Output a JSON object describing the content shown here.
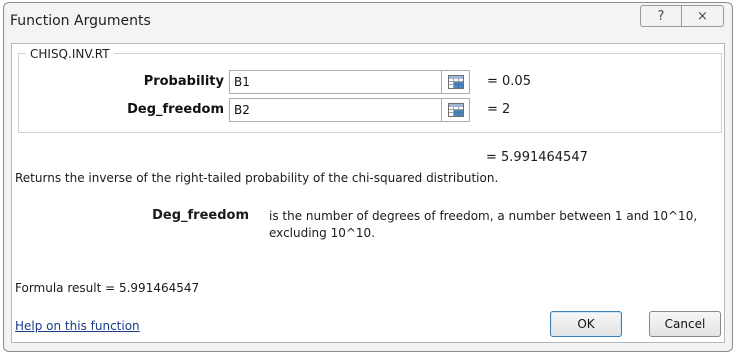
{
  "dialog": {
    "title": "Function Arguments",
    "help_icon": "?",
    "close_icon": "×"
  },
  "function": {
    "name": "CHISQ.INV.RT",
    "arguments": [
      {
        "label": "Probability",
        "value": "B1",
        "result": "=  0.05"
      },
      {
        "label": "Deg_freedom",
        "value": "B2",
        "result": "=  2"
      }
    ],
    "function_result": "=  5.991464547",
    "description": "Returns the inverse of the right-tailed probability of the chi-squared distribution.",
    "arg_help_name": "Deg_freedom",
    "arg_help_text": "is the number of degrees of freedom, a number between 1 and 10^10, excluding 10^10."
  },
  "footer": {
    "formula_result": "Formula result =  5.991464547",
    "help_link": "Help on this function",
    "ok_label": "OK",
    "cancel_label": "Cancel"
  },
  "icons": {
    "ref_button": "range-select-icon"
  }
}
